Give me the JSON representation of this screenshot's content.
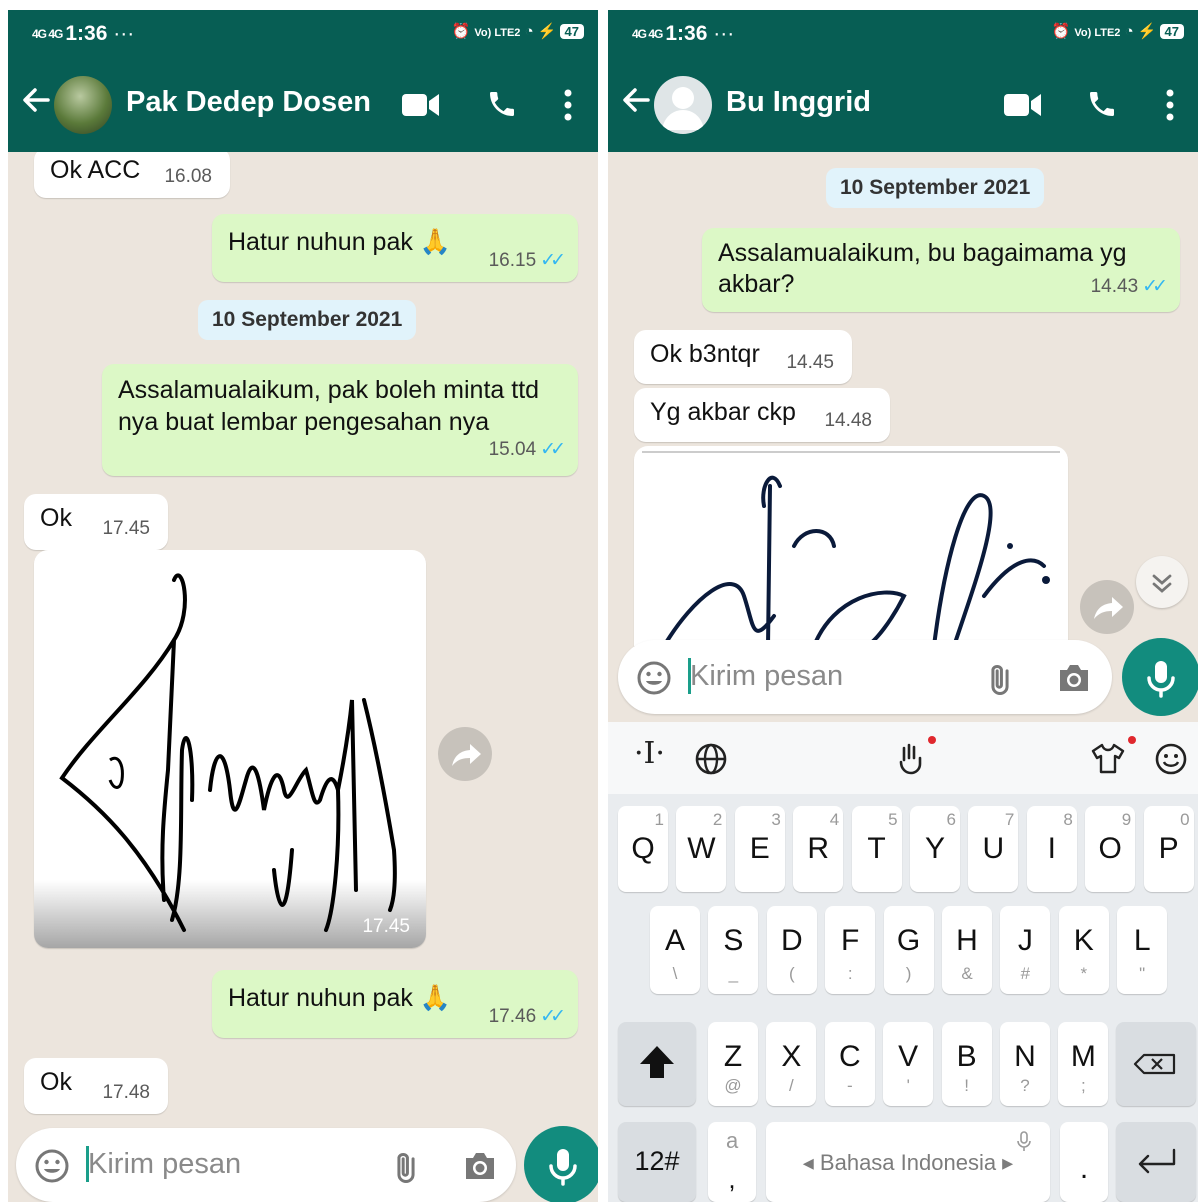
{
  "status": {
    "signal": "4G 4G",
    "time": "1:36",
    "more": "···",
    "net": "Vo) LTE2",
    "battery": "47"
  },
  "left": {
    "contact_name": "Pak Dedep Dosen",
    "messages": [
      {
        "text": "Ok ACC",
        "time": "16.08"
      },
      {
        "text": "Hatur nuhun pak 🙏",
        "time": "16.15"
      },
      {
        "text": "Assalamualaikum, pak boleh minta ttd nya buat lembar pengesahan nya",
        "time": "15.04"
      },
      {
        "text": "Ok",
        "time": "17.45"
      },
      {
        "text": "17.45"
      },
      {
        "text": "Hatur nuhun pak 🙏",
        "time": "17.46"
      },
      {
        "text": "Ok",
        "time": "17.48"
      }
    ],
    "date_chip": "10 September 2021",
    "composer_placeholder": "Kirim pesan"
  },
  "right": {
    "contact_name": "Bu Inggrid",
    "date_chip": "10 September 2021",
    "messages": [
      {
        "text": "Assalamualaikum, bu bagaimama yg akbar?",
        "time": "14.43"
      },
      {
        "text": "Ok b3ntqr",
        "time": "14.45"
      },
      {
        "text": "Yg akbar ckp",
        "time": "14.48"
      }
    ],
    "composer_placeholder": "Kirim pesan"
  },
  "keyboard": {
    "row1": [
      {
        "k": "Q",
        "s": "1"
      },
      {
        "k": "W",
        "s": "2"
      },
      {
        "k": "E",
        "s": "3"
      },
      {
        "k": "R",
        "s": "4"
      },
      {
        "k": "T",
        "s": "5"
      },
      {
        "k": "Y",
        "s": "6"
      },
      {
        "k": "U",
        "s": "7"
      },
      {
        "k": "I",
        "s": "8"
      },
      {
        "k": "O",
        "s": "9"
      },
      {
        "k": "P",
        "s": "0"
      }
    ],
    "row2": [
      {
        "k": "A",
        "s": "\\"
      },
      {
        "k": "S",
        "s": "_"
      },
      {
        "k": "D",
        "s": "("
      },
      {
        "k": "F",
        "s": ":"
      },
      {
        "k": "G",
        "s": ")"
      },
      {
        "k": "H",
        "s": "&"
      },
      {
        "k": "J",
        "s": "#"
      },
      {
        "k": "K",
        "s": "*"
      },
      {
        "k": "L",
        "s": "\""
      }
    ],
    "row3": [
      {
        "k": "Z",
        "s": "@"
      },
      {
        "k": "X",
        "s": "/"
      },
      {
        "k": "C",
        "s": "-"
      },
      {
        "k": "V",
        "s": "'"
      },
      {
        "k": "B",
        "s": "!"
      },
      {
        "k": "N",
        "s": "?"
      },
      {
        "k": "M",
        "s": ";"
      }
    ],
    "numbers_key": "12#",
    "comma_key": ",",
    "comma_sub": "a",
    "space_label": "Bahasa Indonesia",
    "period_key": "."
  }
}
